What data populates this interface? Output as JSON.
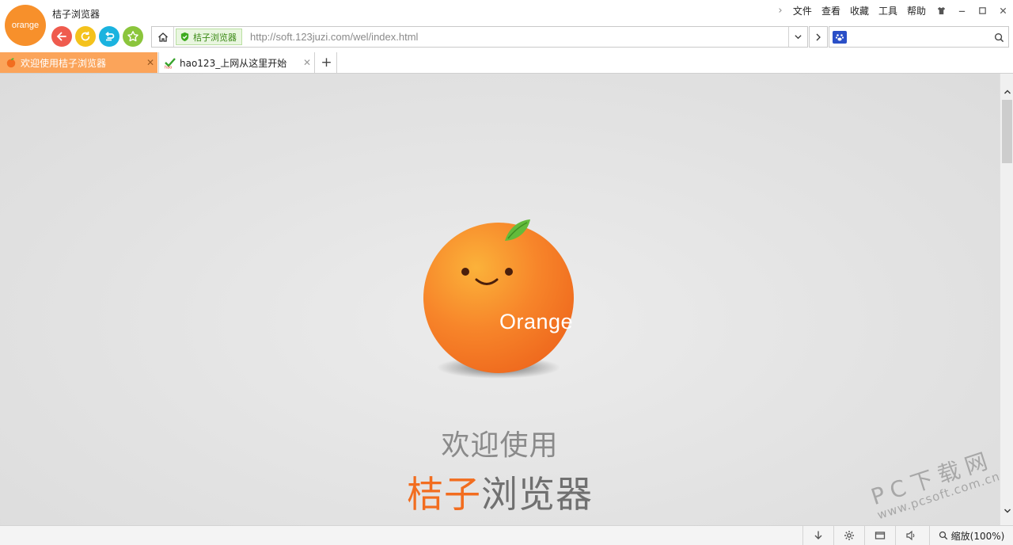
{
  "app": {
    "logo_text": "orange",
    "title": "桔子浏览器"
  },
  "menu": {
    "items": [
      "文件",
      "查看",
      "收藏",
      "工具",
      "帮助"
    ]
  },
  "address_bar": {
    "security_badge": "桔子浏览器",
    "url": "http://soft.123juzi.com/wel/index.html"
  },
  "search": {
    "value": ""
  },
  "tabs": [
    {
      "label": "欢迎使用桔子浏览器",
      "active": true,
      "icon": "orange-favicon-icon"
    },
    {
      "label": "hao123_上网从这里开始",
      "active": false,
      "icon": "hao123-favicon-icon"
    }
  ],
  "content": {
    "mascot_text": "Orange",
    "welcome_line": "欢迎使用",
    "brand_part1": "桔子",
    "brand_part2": "浏览器"
  },
  "watermark": {
    "line1": "PC下载网",
    "line2": "www.pcsoft.com.cn"
  },
  "status": {
    "zoom": "缩放(100%)"
  },
  "colors": {
    "accent": "#f7902b",
    "tab_active": "#fba45a",
    "brand_orange": "#f26d1f"
  }
}
